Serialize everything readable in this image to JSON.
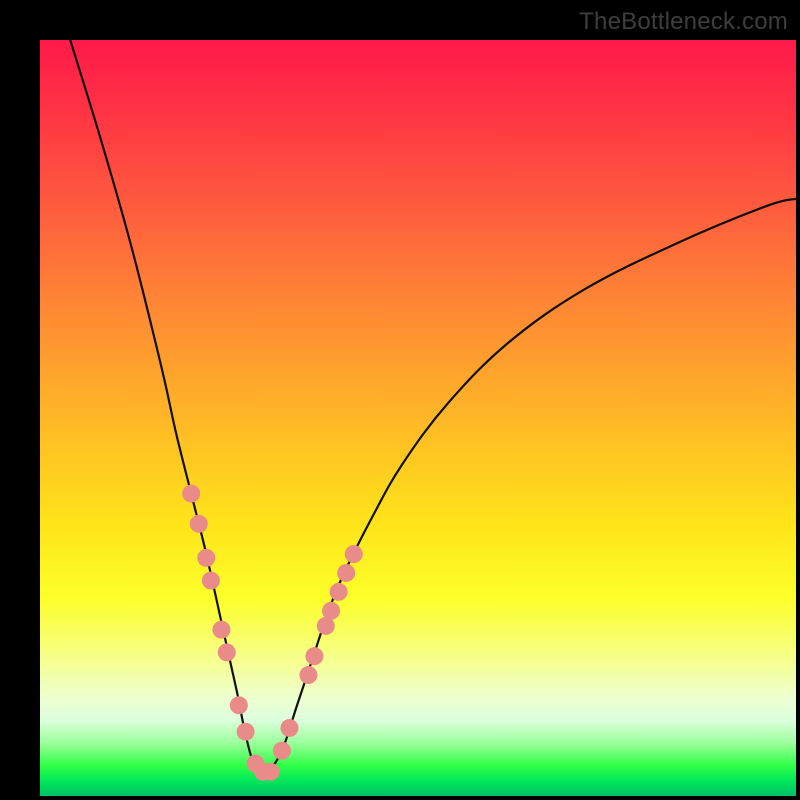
{
  "watermark": "TheBottleneck.com",
  "colors": {
    "curve_stroke": "#101010",
    "marker_fill": "#e98b88",
    "marker_stroke": "#d97a77"
  },
  "chart_data": {
    "type": "line",
    "title": "",
    "xlabel": "",
    "ylabel": "",
    "xlim": [
      0,
      100
    ],
    "ylim": [
      0,
      100
    ],
    "note": "Axes unlabeled; values approximate from pixel positions on a 0–100 normalized scale. Curve is a V-shaped bottleneck profile with minimum near x≈29.",
    "series": [
      {
        "name": "bottleneck-curve",
        "x": [
          4,
          8,
          12,
          16,
          18,
          20,
          22,
          24,
          26,
          27,
          28,
          29,
          30,
          32,
          34,
          36,
          38,
          40,
          44,
          48,
          54,
          62,
          72,
          84,
          96,
          100
        ],
        "y": [
          100,
          87,
          73,
          57,
          48,
          40,
          32,
          23,
          14,
          9,
          5,
          3,
          3,
          6,
          12,
          18,
          24,
          29,
          37,
          44,
          52,
          60,
          67,
          73,
          78,
          79
        ]
      }
    ],
    "markers": {
      "name": "highlighted-points",
      "x": [
        20.0,
        21.0,
        22.0,
        22.6,
        24.0,
        24.7,
        26.3,
        27.2,
        28.5,
        29.5,
        30.5,
        32.0,
        33.0,
        35.5,
        36.3,
        37.8,
        38.5,
        39.5,
        40.5,
        41.5
      ],
      "y": [
        40.0,
        36.0,
        31.5,
        28.5,
        22.0,
        19.0,
        12.0,
        8.5,
        4.3,
        3.2,
        3.2,
        6.0,
        9.0,
        16.0,
        18.5,
        22.5,
        24.5,
        27.0,
        29.5,
        32.0
      ]
    }
  }
}
